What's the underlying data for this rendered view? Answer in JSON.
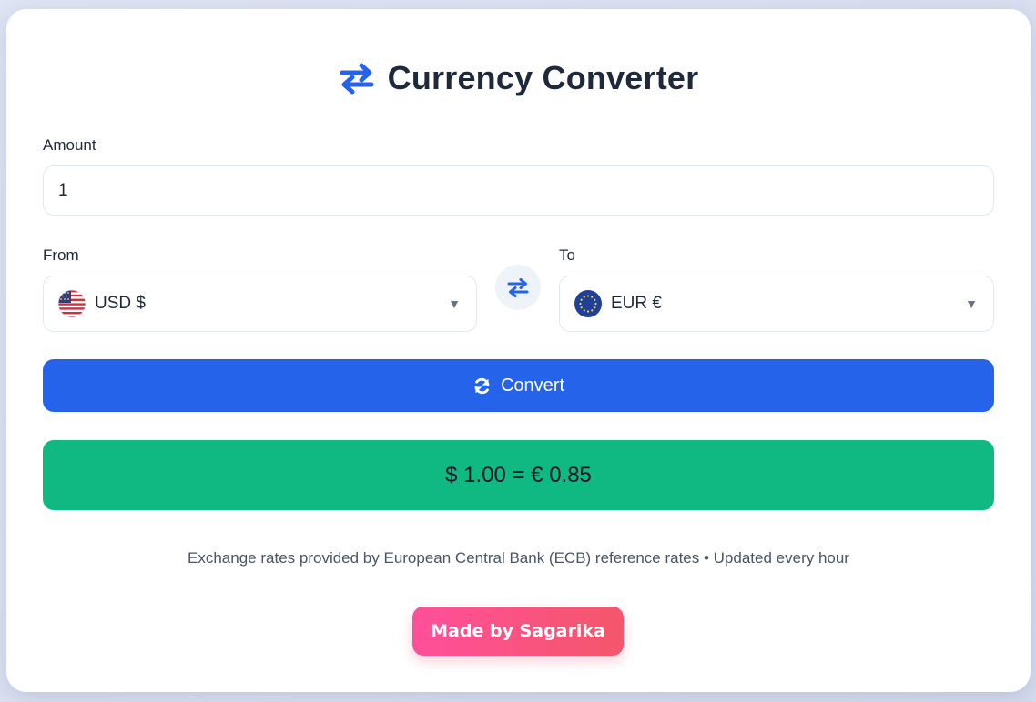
{
  "header": {
    "title": "Currency Converter",
    "icon": "exchange-arrows-icon"
  },
  "amount": {
    "label": "Amount",
    "value": "1"
  },
  "from": {
    "label": "From",
    "currency": "USD $",
    "flag": "us-flag-icon"
  },
  "to": {
    "label": "To",
    "currency": "EUR €",
    "flag": "eu-flag-icon"
  },
  "swap": {
    "icon": "swap-arrows-icon"
  },
  "convert": {
    "label": "Convert",
    "icon": "refresh-icon"
  },
  "result": {
    "text": "$ 1.00 = € 0.85"
  },
  "footer": {
    "note": "Exchange rates provided by European Central Bank (ECB) reference rates • Updated every hour",
    "credit": "Made by Sagarika"
  },
  "colors": {
    "accent": "#2563eb",
    "success": "#10b981",
    "credit_gradient_start": "#ff4f9a",
    "credit_gradient_end": "#f4576a"
  }
}
